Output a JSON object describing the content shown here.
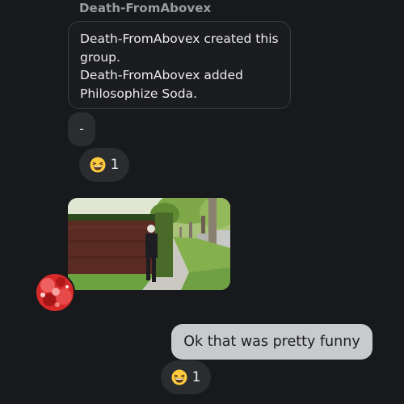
{
  "thread": {
    "sender_name": "Death-FromAbovex",
    "system_message": {
      "line1": "Death-FromAbovex created this",
      "line2": "group.",
      "line3": "Death-FromAbovex added",
      "line4": "Philosophize Soda."
    },
    "dash_message": "-",
    "reaction_1": {
      "emoji": "grinning-squinting-face",
      "count": "1"
    },
    "photo_message": {
      "type": "image",
      "description_icon": "photo-street-scene"
    },
    "outgoing_message": "Ok that was pretty funny",
    "reaction_2": {
      "emoji": "grinning-squinting-face",
      "count": "1"
    }
  },
  "colors": {
    "background": "#18191d",
    "incoming_bubble": "#2b2c30",
    "outgoing_bubble": "#c9cacd",
    "name_text": "#9b9ca0"
  }
}
